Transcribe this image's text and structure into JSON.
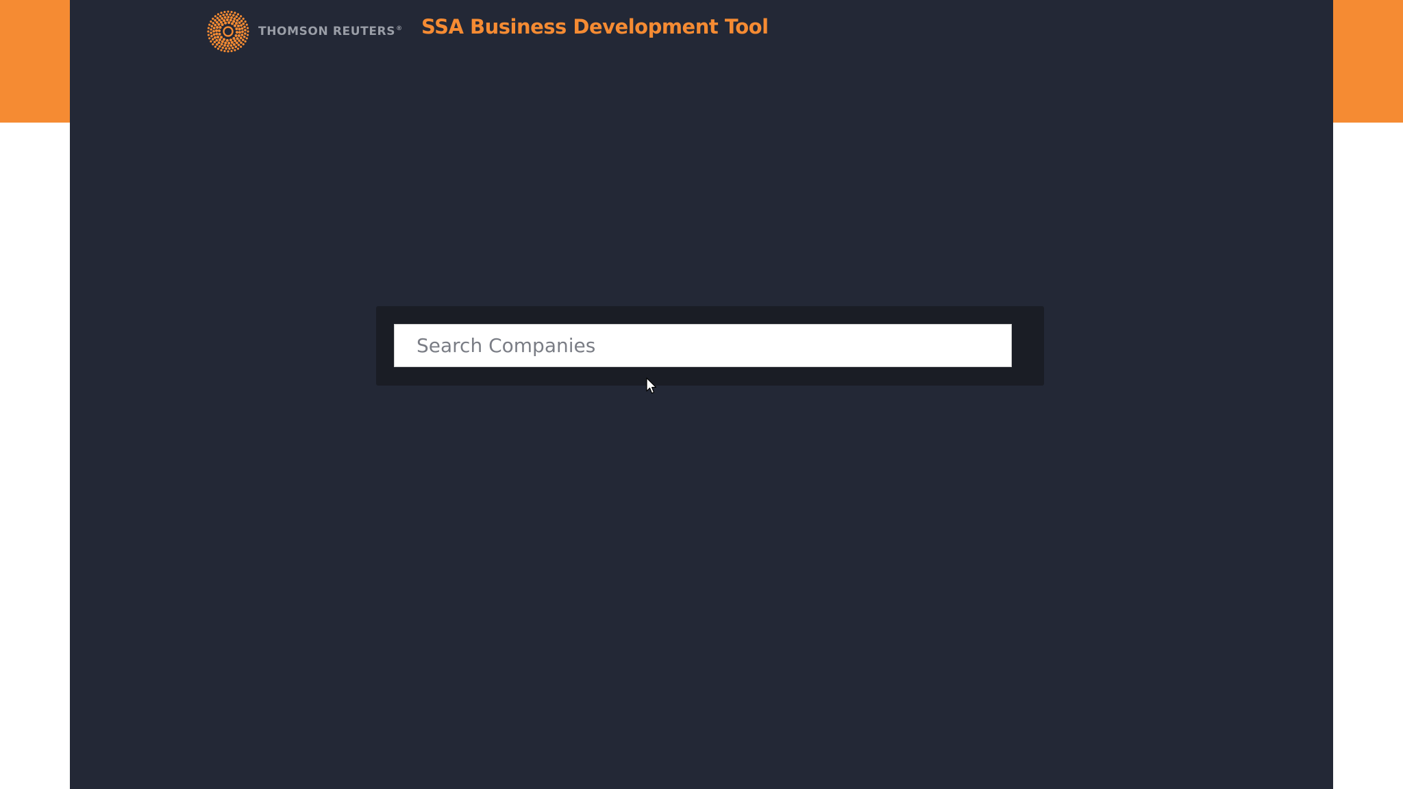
{
  "header": {
    "brand_name": "THOMSON REUTERS",
    "brand_mark": "®",
    "app_title": "SSA Business Development Tool"
  },
  "search": {
    "placeholder": "Search Companies",
    "value": ""
  },
  "colors": {
    "accent": "#f58b33",
    "background": "#232836",
    "panel": "#1a1d25",
    "brand_gray": "#9a9ea7"
  },
  "icons": {
    "logo": "thomson-reuters-logo-icon",
    "pointer": "mouse-pointer-icon"
  }
}
